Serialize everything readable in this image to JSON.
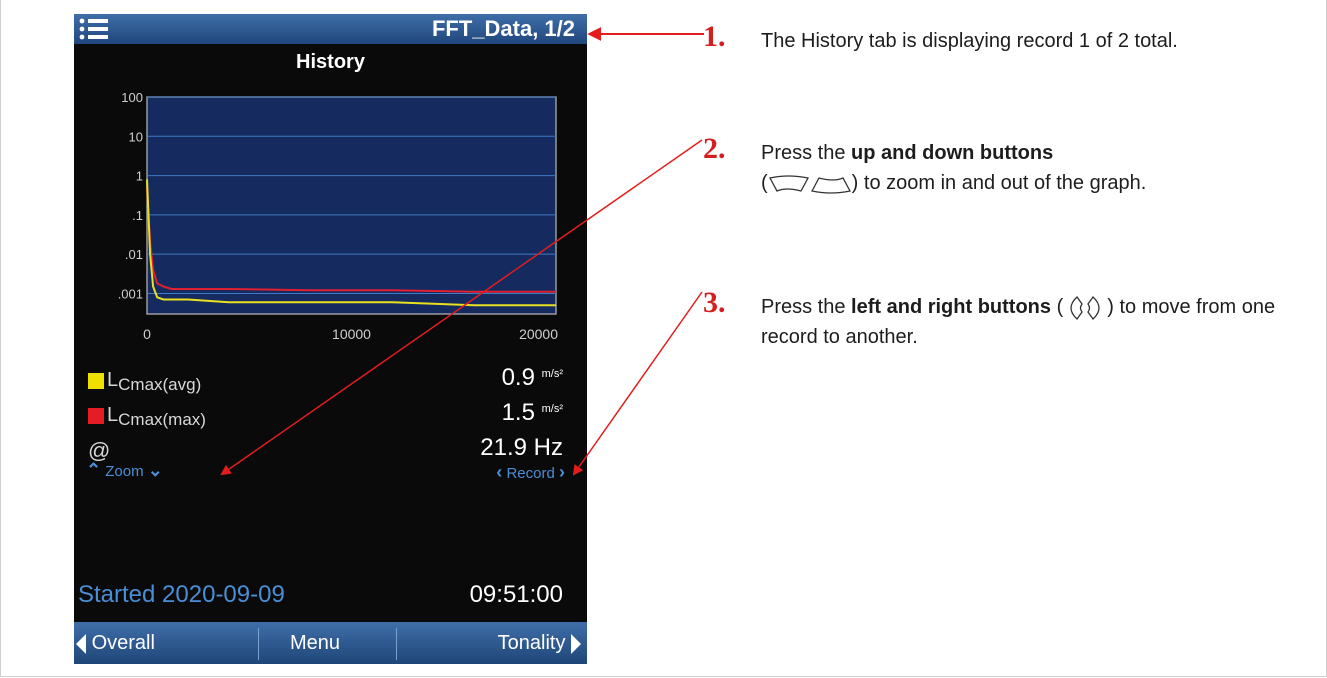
{
  "device": {
    "window_title": "FFT_Data, 1/2",
    "tab_title": "History",
    "chart_data": {
      "type": "line",
      "xlabel": "",
      "ylabel": "",
      "x_ticks": [
        "0",
        "10000",
        "20000"
      ],
      "y_ticks": [
        "100",
        "10",
        "1",
        ".1",
        ".01",
        ".001"
      ],
      "y_scale": "log",
      "xlim": [
        0,
        20000
      ],
      "ylim": [
        0.0003,
        100
      ],
      "grid": true,
      "series": [
        {
          "name": "LCmax(max)",
          "color": "#e02030",
          "x": [
            0,
            150,
            300,
            500,
            800,
            1200,
            2000,
            4000,
            8000,
            12000,
            16000,
            20000
          ],
          "values": [
            0.5,
            0.02,
            0.004,
            0.0018,
            0.0015,
            0.0013,
            0.0013,
            0.0013,
            0.0012,
            0.0012,
            0.0011,
            0.0011
          ]
        },
        {
          "name": "LCmax(avg)",
          "color": "#e8e020",
          "x": [
            0,
            150,
            300,
            500,
            800,
            1200,
            2000,
            4000,
            8000,
            12000,
            16000,
            20000
          ],
          "values": [
            0.8,
            0.01,
            0.0015,
            0.0008,
            0.0007,
            0.0007,
            0.0007,
            0.0006,
            0.0006,
            0.0006,
            0.0005,
            0.0005
          ]
        }
      ]
    },
    "legend": [
      {
        "label_main": "L",
        "label_sub": "Cmax(avg)",
        "color": "#f0e000",
        "value": "0.9",
        "unit": "m/s²"
      },
      {
        "label_main": "L",
        "label_sub": "Cmax(max)",
        "color": "#e51c23",
        "value": "1.5",
        "unit": "m/s²"
      }
    ],
    "at_label": "@",
    "frequency_value": "21.9 Hz",
    "zoom_label": "Zoom",
    "record_label": "Record",
    "started_label": "Started 2020-09-09",
    "time_label": "09:51:00",
    "bottom_bar": {
      "left": "Overall",
      "center": "Menu",
      "right": "Tonality"
    }
  },
  "steps": [
    {
      "number": "1.",
      "text": "The History tab is displaying record 1 of 2 total."
    },
    {
      "number": "2.",
      "before": "Press the ",
      "bold": "up and down buttons",
      "after": ") to zoom in and out of the graph.",
      "paren_open": "("
    },
    {
      "number": "3.",
      "before": "Press the ",
      "bold": "left and right buttons",
      "after": ") to move from one record to another.",
      "paren_open": "("
    }
  ],
  "colors": {
    "annotation": "#e41c1c",
    "accent": "#4a8ed6",
    "titlebar": "#2c5a92"
  }
}
